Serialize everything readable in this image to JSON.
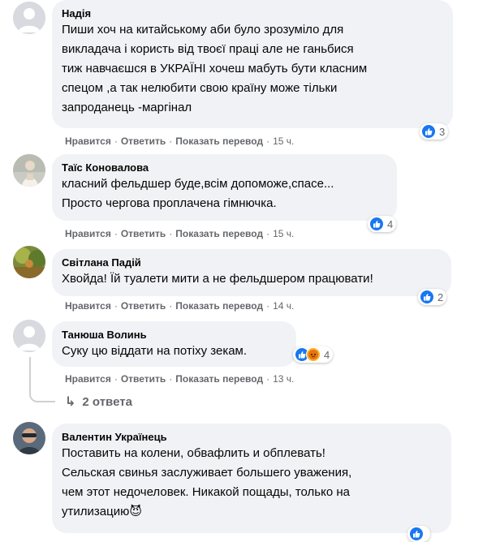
{
  "actions": {
    "like": "Нравится",
    "reply": "Ответить",
    "translate": "Показать перевод"
  },
  "comments": [
    {
      "author": "Надія",
      "text": "Пиши хоч на китайському аби було зрозуміло для\nвикладача і користь від твоєї праці але не ганьбися\nтиж навчаєшся в УКРАЇНІ хочеш мабуть бути класним\nспецом ,а так нелюбити свою країну може тільки\nзапроданець -маргінал",
      "time": "15 ч.",
      "reactions": "3",
      "reaction_icons": [
        "like-icon"
      ]
    },
    {
      "author": "Таїс Коновалова",
      "text": "класний фельдшер буде,всім допоможе,спасе...\nПросто чергова проплачена гімнючка.",
      "time": "15 ч.",
      "reactions": "4",
      "reaction_icons": [
        "like-icon"
      ]
    },
    {
      "author": "Світлана Падій",
      "text": "Хвойда! Їй туалети мити а не фельдшером працювати!",
      "time": "14 ч.",
      "reactions": "2",
      "reaction_icons": [
        "like-icon"
      ]
    },
    {
      "author": "Танюша Волинь",
      "text": "Суку цю віддати на потіху зекам.",
      "time": "13 ч.",
      "reactions": "4",
      "reaction_icons": [
        "like-icon",
        "angry-icon"
      ]
    },
    {
      "author": "Валентин Українець",
      "text": "Поставить на колени, обвафлить и обплевать!\nСельская свинья заслуживает большего уважения,\nчем этот недочеловек. Никакой пощады, только на\nутилизацию😈",
      "reactions": "",
      "reaction_icons": [
        "like-icon"
      ]
    }
  ],
  "replies_link": {
    "label": "2 ответа",
    "icon": "reply-arrow-icon"
  },
  "colors": {
    "bubble": "#f0f2f5",
    "meta_text": "#65676b",
    "like_blue": "#1877f2",
    "angry_orange": "#f7b125"
  }
}
